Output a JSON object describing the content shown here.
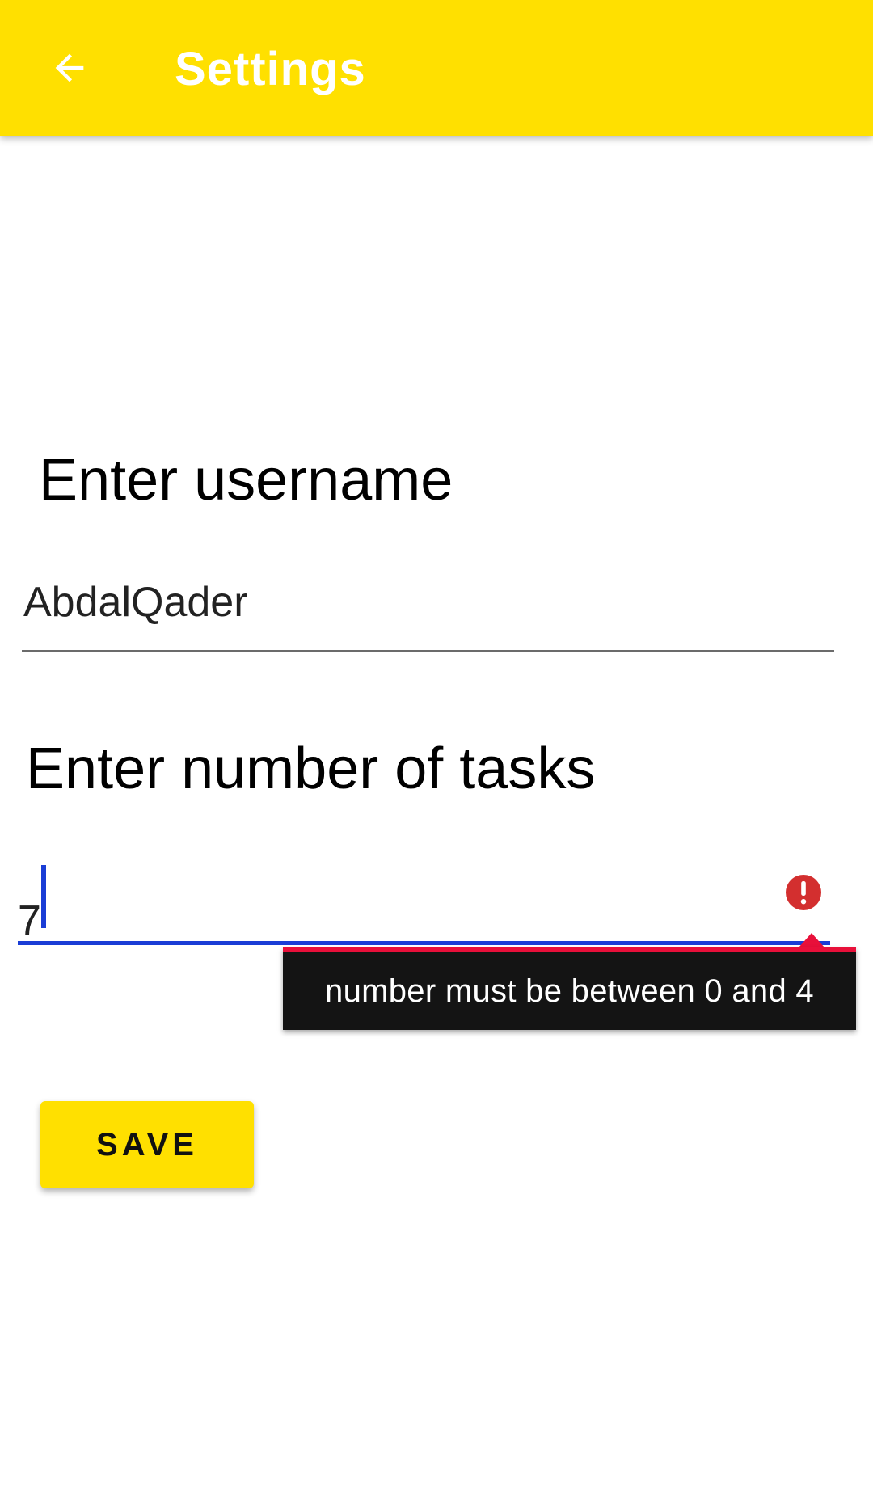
{
  "app_bar": {
    "title": "Settings",
    "back_icon": "arrow-left-icon",
    "background_color": "#FFE000"
  },
  "form": {
    "username_label": "Enter username",
    "username_value": "AbdalQader",
    "tasks_label": "Enter number of tasks",
    "tasks_value": "7",
    "error_icon": "exclamation-circle-icon",
    "error_message": "number must be between 0 and 4",
    "save_label": "SAVE"
  },
  "colors": {
    "accent": "#FFE000",
    "focus_underline": "#1a3dd6",
    "error": "#d32f2f",
    "error_border": "#e8103a"
  }
}
